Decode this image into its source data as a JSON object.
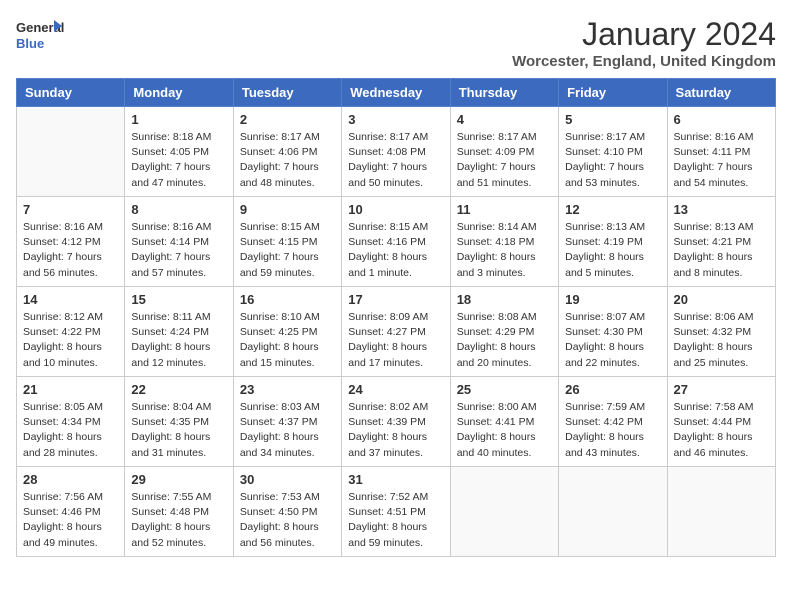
{
  "header": {
    "logo_general": "General",
    "logo_blue": "Blue",
    "month": "January 2024",
    "location": "Worcester, England, United Kingdom"
  },
  "days_of_week": [
    "Sunday",
    "Monday",
    "Tuesday",
    "Wednesday",
    "Thursday",
    "Friday",
    "Saturday"
  ],
  "weeks": [
    [
      {
        "day": "",
        "info": ""
      },
      {
        "day": "1",
        "info": "Sunrise: 8:18 AM\nSunset: 4:05 PM\nDaylight: 7 hours\nand 47 minutes."
      },
      {
        "day": "2",
        "info": "Sunrise: 8:17 AM\nSunset: 4:06 PM\nDaylight: 7 hours\nand 48 minutes."
      },
      {
        "day": "3",
        "info": "Sunrise: 8:17 AM\nSunset: 4:08 PM\nDaylight: 7 hours\nand 50 minutes."
      },
      {
        "day": "4",
        "info": "Sunrise: 8:17 AM\nSunset: 4:09 PM\nDaylight: 7 hours\nand 51 minutes."
      },
      {
        "day": "5",
        "info": "Sunrise: 8:17 AM\nSunset: 4:10 PM\nDaylight: 7 hours\nand 53 minutes."
      },
      {
        "day": "6",
        "info": "Sunrise: 8:16 AM\nSunset: 4:11 PM\nDaylight: 7 hours\nand 54 minutes."
      }
    ],
    [
      {
        "day": "7",
        "info": "Sunrise: 8:16 AM\nSunset: 4:12 PM\nDaylight: 7 hours\nand 56 minutes."
      },
      {
        "day": "8",
        "info": "Sunrise: 8:16 AM\nSunset: 4:14 PM\nDaylight: 7 hours\nand 57 minutes."
      },
      {
        "day": "9",
        "info": "Sunrise: 8:15 AM\nSunset: 4:15 PM\nDaylight: 7 hours\nand 59 minutes."
      },
      {
        "day": "10",
        "info": "Sunrise: 8:15 AM\nSunset: 4:16 PM\nDaylight: 8 hours\nand 1 minute."
      },
      {
        "day": "11",
        "info": "Sunrise: 8:14 AM\nSunset: 4:18 PM\nDaylight: 8 hours\nand 3 minutes."
      },
      {
        "day": "12",
        "info": "Sunrise: 8:13 AM\nSunset: 4:19 PM\nDaylight: 8 hours\nand 5 minutes."
      },
      {
        "day": "13",
        "info": "Sunrise: 8:13 AM\nSunset: 4:21 PM\nDaylight: 8 hours\nand 8 minutes."
      }
    ],
    [
      {
        "day": "14",
        "info": "Sunrise: 8:12 AM\nSunset: 4:22 PM\nDaylight: 8 hours\nand 10 minutes."
      },
      {
        "day": "15",
        "info": "Sunrise: 8:11 AM\nSunset: 4:24 PM\nDaylight: 8 hours\nand 12 minutes."
      },
      {
        "day": "16",
        "info": "Sunrise: 8:10 AM\nSunset: 4:25 PM\nDaylight: 8 hours\nand 15 minutes."
      },
      {
        "day": "17",
        "info": "Sunrise: 8:09 AM\nSunset: 4:27 PM\nDaylight: 8 hours\nand 17 minutes."
      },
      {
        "day": "18",
        "info": "Sunrise: 8:08 AM\nSunset: 4:29 PM\nDaylight: 8 hours\nand 20 minutes."
      },
      {
        "day": "19",
        "info": "Sunrise: 8:07 AM\nSunset: 4:30 PM\nDaylight: 8 hours\nand 22 minutes."
      },
      {
        "day": "20",
        "info": "Sunrise: 8:06 AM\nSunset: 4:32 PM\nDaylight: 8 hours\nand 25 minutes."
      }
    ],
    [
      {
        "day": "21",
        "info": "Sunrise: 8:05 AM\nSunset: 4:34 PM\nDaylight: 8 hours\nand 28 minutes."
      },
      {
        "day": "22",
        "info": "Sunrise: 8:04 AM\nSunset: 4:35 PM\nDaylight: 8 hours\nand 31 minutes."
      },
      {
        "day": "23",
        "info": "Sunrise: 8:03 AM\nSunset: 4:37 PM\nDaylight: 8 hours\nand 34 minutes."
      },
      {
        "day": "24",
        "info": "Sunrise: 8:02 AM\nSunset: 4:39 PM\nDaylight: 8 hours\nand 37 minutes."
      },
      {
        "day": "25",
        "info": "Sunrise: 8:00 AM\nSunset: 4:41 PM\nDaylight: 8 hours\nand 40 minutes."
      },
      {
        "day": "26",
        "info": "Sunrise: 7:59 AM\nSunset: 4:42 PM\nDaylight: 8 hours\nand 43 minutes."
      },
      {
        "day": "27",
        "info": "Sunrise: 7:58 AM\nSunset: 4:44 PM\nDaylight: 8 hours\nand 46 minutes."
      }
    ],
    [
      {
        "day": "28",
        "info": "Sunrise: 7:56 AM\nSunset: 4:46 PM\nDaylight: 8 hours\nand 49 minutes."
      },
      {
        "day": "29",
        "info": "Sunrise: 7:55 AM\nSunset: 4:48 PM\nDaylight: 8 hours\nand 52 minutes."
      },
      {
        "day": "30",
        "info": "Sunrise: 7:53 AM\nSunset: 4:50 PM\nDaylight: 8 hours\nand 56 minutes."
      },
      {
        "day": "31",
        "info": "Sunrise: 7:52 AM\nSunset: 4:51 PM\nDaylight: 8 hours\nand 59 minutes."
      },
      {
        "day": "",
        "info": ""
      },
      {
        "day": "",
        "info": ""
      },
      {
        "day": "",
        "info": ""
      }
    ]
  ]
}
